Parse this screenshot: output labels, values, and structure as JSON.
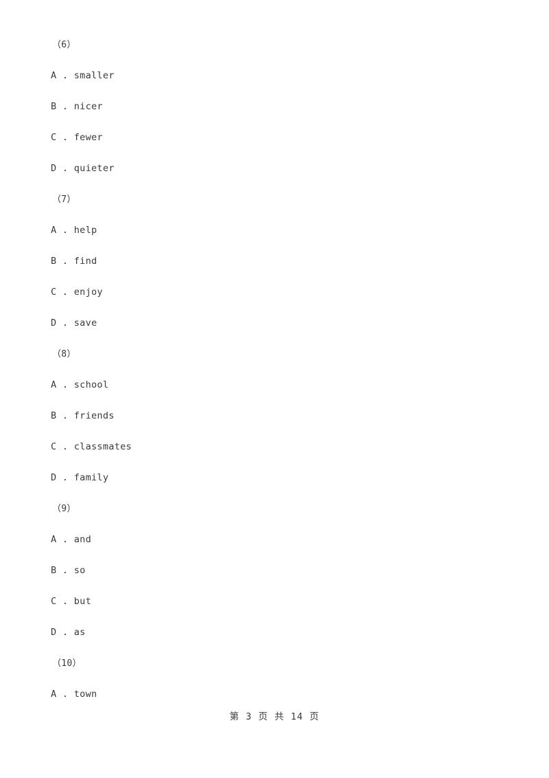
{
  "document": {
    "page_background": "#ffffff",
    "text_color": "#3a3a3a"
  },
  "questions": [
    {
      "number": "（6）",
      "options": [
        "A . smaller",
        "B . nicer",
        "C . fewer",
        "D . quieter"
      ]
    },
    {
      "number": "（7）",
      "options": [
        "A . help",
        "B . find",
        "C . enjoy",
        "D . save"
      ]
    },
    {
      "number": "（8）",
      "options": [
        "A . school",
        "B . friends",
        "C . classmates",
        "D . family"
      ]
    },
    {
      "number": "（9）",
      "options": [
        "A . and",
        "B . so",
        "C . but",
        "D . as"
      ]
    },
    {
      "number": "（10）",
      "options": [
        "A . town"
      ]
    }
  ],
  "footer": {
    "page_label": "第 3 页 共 14 页",
    "current_page": "3",
    "total_pages": "14"
  }
}
